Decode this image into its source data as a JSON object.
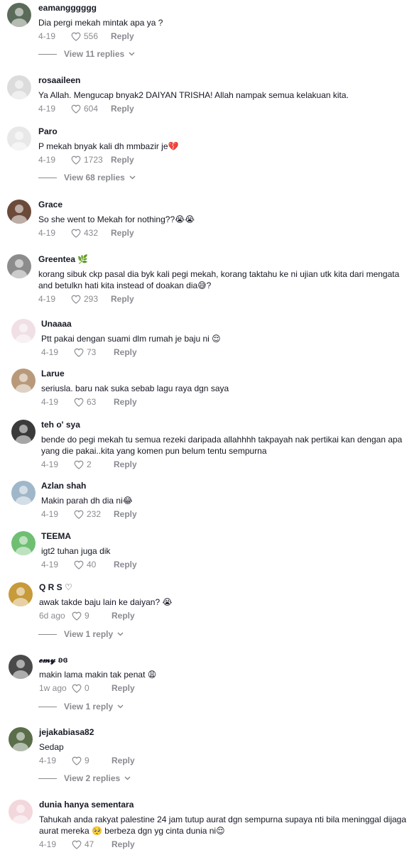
{
  "comments": [
    {
      "user": "eamangggggg",
      "text": "Dia pergi mekah mintak apa ya ?",
      "date": "4-19",
      "likes": "556",
      "reply": "Reply",
      "replies": "View 11 replies",
      "avatar_color": "#5b6b5a"
    },
    {
      "user": "rosaaileen",
      "text": "Ya Allah. Mengucap bnyak2 DAIYAN TRISHA! Allah nampak semua kelakuan kita.",
      "date": "4-19",
      "likes": "604",
      "reply": "Reply",
      "replies": "",
      "avatar_color": "#dcdcdc"
    },
    {
      "user": "Paro",
      "text": "P mekah bnyak kali dh mmbazir je💔",
      "date": "4-19",
      "likes": "1723",
      "reply": "Reply",
      "replies": "View 68 replies",
      "avatar_color": "#e8e8e8"
    },
    {
      "user": "Grace",
      "text": "So she went to Mekah for nothing??😭😭",
      "date": "4-19",
      "likes": "432",
      "reply": "Reply",
      "replies": "",
      "avatar_color": "#6b4a3a"
    },
    {
      "user": "Greentea 🌿",
      "text": "korang sibuk ckp pasal dia byk kali pegi mekah, korang taktahu ke ni ujian utk kita dari mengata and betulkn hati kita instead of doakan dia😅?",
      "date": "4-19",
      "likes": "293",
      "reply": "Reply",
      "replies": "",
      "avatar_color": "#8c8c8c"
    },
    {
      "user": "Unaaaa",
      "text": "Ptt pakai dengan suami dlm rumah je baju ni 😌",
      "date": "4-19",
      "likes": "73",
      "reply": "Reply",
      "replies": "",
      "avatar_color": "#f0e0e6"
    },
    {
      "user": "Larue",
      "text": "seriusla. baru nak suka sebab lagu raya dgn saya",
      "date": "4-19",
      "likes": "63",
      "reply": "Reply",
      "replies": "",
      "avatar_color": "#b89a7a"
    },
    {
      "user": "teh o' sya",
      "text": "bende do pegi mekah tu semua rezeki daripada allahhhh takpayah nak pertikai kan dengan apa yang die pakai..kita yang komen pun belum tentu sempurna",
      "date": "4-19",
      "likes": "2",
      "reply": "Reply",
      "replies": "",
      "avatar_color": "#3a3a3a"
    },
    {
      "user": "Azlan shah",
      "text": "Makin parah dh dia ni😂",
      "date": "4-19",
      "likes": "232",
      "reply": "Reply",
      "replies": "",
      "avatar_color": "#9fb7c9"
    },
    {
      "user": "TEEMA",
      "text": "igt2 tuhan juga dik",
      "date": "4-19",
      "likes": "40",
      "reply": "Reply",
      "replies": "",
      "avatar_color": "#6fbf73"
    },
    {
      "user": "Q R S ♡",
      "text": "awak takde baju lain ke daiyan? 😭",
      "date": "6d ago",
      "likes": "9",
      "reply": "Reply",
      "replies": "View 1 reply",
      "avatar_color": "#c79a3a"
    },
    {
      "user": "𝓮𝓶𝔂 ʚɞ",
      "text": "makin lama makin tak penat 😩",
      "date": "1w ago",
      "likes": "0",
      "reply": "Reply",
      "replies": "View 1 reply",
      "avatar_color": "#4a4a4a"
    },
    {
      "user": "jejakabiasa82",
      "text": "Sedap",
      "date": "4-19",
      "likes": "9",
      "reply": "Reply",
      "replies": "View 2 replies",
      "avatar_color": "#5a6e4a"
    },
    {
      "user": "dunia hanya sementara",
      "text": "Tahukah anda rakyat palestine 24 jam tutup aurat dgn sempurna supaya nti bila meninggal dijaga aurat mereka 🥺 berbeza dgn yg cinta dunia ni😌",
      "date": "4-19",
      "likes": "47",
      "reply": "Reply",
      "replies": "",
      "avatar_color": "#f2d7dc"
    }
  ]
}
